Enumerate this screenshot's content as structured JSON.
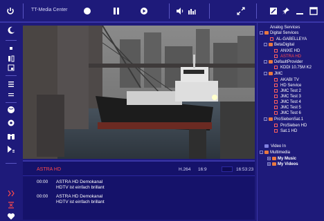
{
  "toolbar": {
    "title": "TT-Media Center"
  },
  "info": {
    "channel": "ASTRA HD",
    "codec": "H.264",
    "aspect": "16:9",
    "time": "16:53:23",
    "events": [
      {
        "time": "00:00",
        "title": "ASTRA HD Demokanal",
        "subtitle": "HDTV ist einfach brillant"
      },
      {
        "time": "00:00",
        "title": "ASTRA HD Demokanal",
        "subtitle": "HDTV ist einfach brillant"
      }
    ]
  },
  "tree": {
    "analog": "Analog Services",
    "digital": "Digital Services",
    "al_gabelleya": "AL-GABELLEYA",
    "beta": "BetaDigital",
    "anixe": "ANIXE HD",
    "astra": "ASTRA HD",
    "default": "DefaultProvider",
    "kddi": "KDDI 10.75M K2",
    "jmc": "JMC",
    "akabi": "AKABI TV",
    "hd_service": "HD Service",
    "jmc2": "JMC Test 2",
    "jmc3": "JMC Test 3",
    "jmc4": "JMC Test 4",
    "jmc5": "JMC Test 5",
    "jmc6": "JMC Test 6",
    "pro7sat1": "ProSiebenSat.1",
    "pro7hd": "ProSieben HD",
    "sat1hd": "Sat.1 HD",
    "video_in": "Video In",
    "multimedia": "Multimedia",
    "music": "My Music",
    "videos": "My Videos"
  }
}
